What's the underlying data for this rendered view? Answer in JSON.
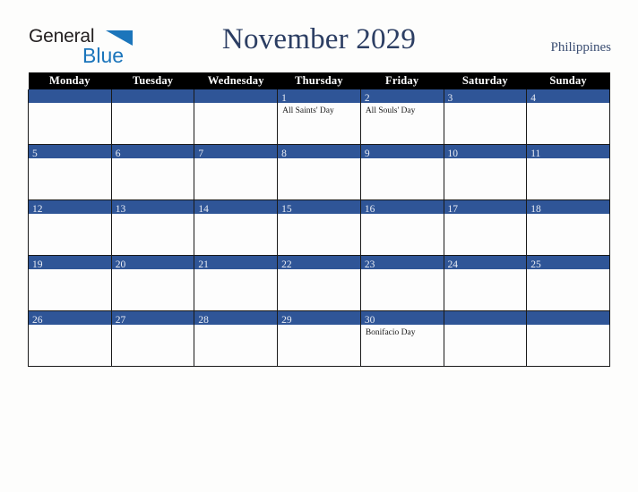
{
  "brand": {
    "name_part1": "General",
    "name_part2": "Blue",
    "triangle_color": "#1b75bb",
    "text_color": "#231f20"
  },
  "header": {
    "title": "November 2029",
    "country": "Philippines",
    "title_color": "#2c3e63"
  },
  "calendar": {
    "accent_color": "#2f5597",
    "header_bg": "#000000",
    "weekday_headers": [
      "Monday",
      "Tuesday",
      "Wednesday",
      "Thursday",
      "Friday",
      "Saturday",
      "Sunday"
    ],
    "weeks": [
      [
        {
          "day": "",
          "events": []
        },
        {
          "day": "",
          "events": []
        },
        {
          "day": "",
          "events": []
        },
        {
          "day": "1",
          "events": [
            "All Saints' Day"
          ]
        },
        {
          "day": "2",
          "events": [
            "All Souls' Day"
          ]
        },
        {
          "day": "3",
          "events": []
        },
        {
          "day": "4",
          "events": []
        }
      ],
      [
        {
          "day": "5",
          "events": []
        },
        {
          "day": "6",
          "events": []
        },
        {
          "day": "7",
          "events": []
        },
        {
          "day": "8",
          "events": []
        },
        {
          "day": "9",
          "events": []
        },
        {
          "day": "10",
          "events": []
        },
        {
          "day": "11",
          "events": []
        }
      ],
      [
        {
          "day": "12",
          "events": []
        },
        {
          "day": "13",
          "events": []
        },
        {
          "day": "14",
          "events": []
        },
        {
          "day": "15",
          "events": []
        },
        {
          "day": "16",
          "events": []
        },
        {
          "day": "17",
          "events": []
        },
        {
          "day": "18",
          "events": []
        }
      ],
      [
        {
          "day": "19",
          "events": []
        },
        {
          "day": "20",
          "events": []
        },
        {
          "day": "21",
          "events": []
        },
        {
          "day": "22",
          "events": []
        },
        {
          "day": "23",
          "events": []
        },
        {
          "day": "24",
          "events": []
        },
        {
          "day": "25",
          "events": []
        }
      ],
      [
        {
          "day": "26",
          "events": []
        },
        {
          "day": "27",
          "events": []
        },
        {
          "day": "28",
          "events": []
        },
        {
          "day": "29",
          "events": []
        },
        {
          "day": "30",
          "events": [
            "Bonifacio Day"
          ]
        },
        {
          "day": "",
          "events": []
        },
        {
          "day": "",
          "events": []
        }
      ]
    ]
  }
}
